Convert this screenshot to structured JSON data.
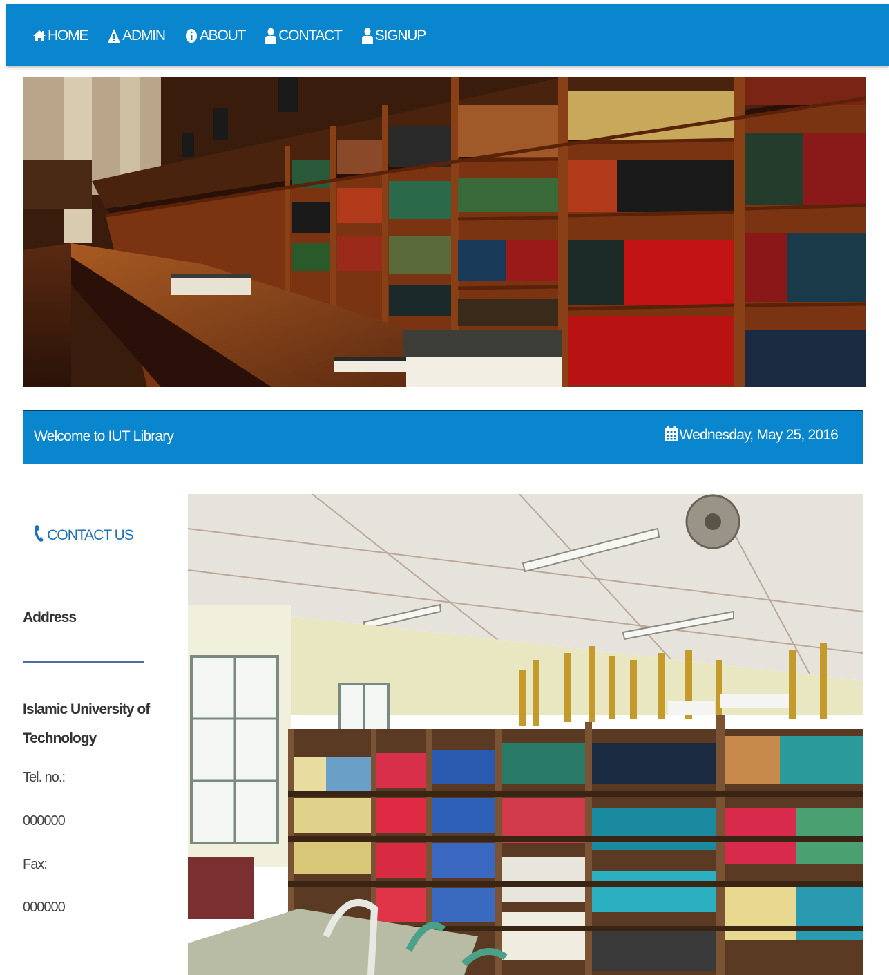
{
  "nav": {
    "items": [
      {
        "label": "HOME",
        "icon": "home-icon"
      },
      {
        "label": "ADMIN",
        "icon": "warning-icon"
      },
      {
        "label": "ABOUT",
        "icon": "info-icon"
      },
      {
        "label": "CONTACT",
        "icon": "user-icon"
      },
      {
        "label": "SIGNUP",
        "icon": "user-icon"
      }
    ]
  },
  "welcome": {
    "text": "Welcome to IUT Library",
    "date": "Wednesday, May 25, 2016",
    "date_icon": "calendar-icon"
  },
  "sidebar": {
    "contact_button": "CONTACT US",
    "contact_icon": "phone-icon",
    "address_heading": "Address",
    "institution": "Islamic University of Technology",
    "tel_label": "Tel. no.:",
    "tel_value": "000000",
    "fax_label": "Fax:",
    "fax_value": "000000"
  },
  "colors": {
    "primary": "#0a86cf",
    "accent_text": "#1a72b8"
  }
}
